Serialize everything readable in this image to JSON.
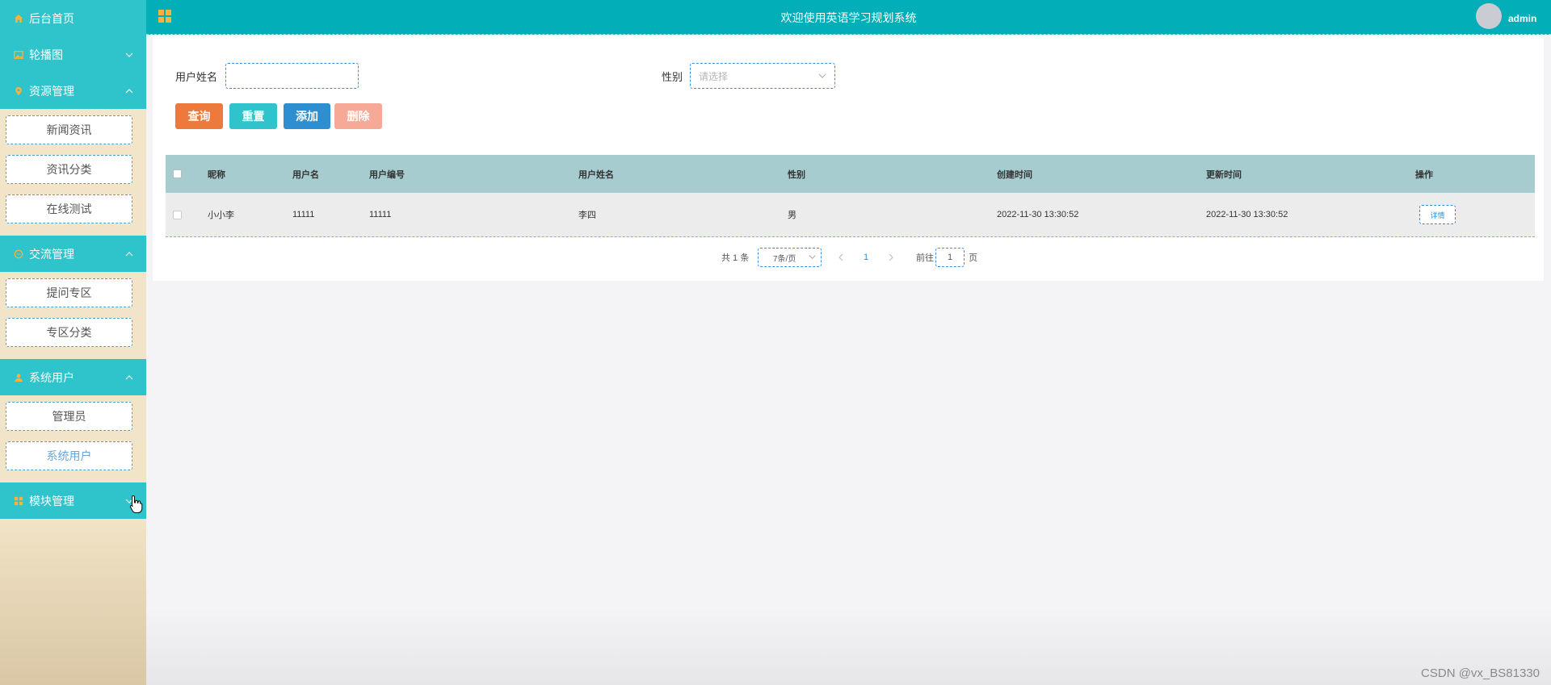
{
  "header": {
    "title": "欢迎使用英语学习规划系统",
    "username": "admin"
  },
  "sidebar": {
    "home": "后台首页",
    "carousel": "轮播图",
    "resource": {
      "label": "资源管理",
      "items": [
        "新闻资讯",
        "资讯分类",
        "在线测试"
      ]
    },
    "exchange": {
      "label": "交流管理",
      "items": [
        "提问专区",
        "专区分类"
      ]
    },
    "sysuser": {
      "label": "系统用户",
      "items": [
        "管理员",
        "系统用户"
      ]
    },
    "module": "模块管理"
  },
  "form": {
    "name_label": "用户姓名",
    "name_value": "",
    "gender_label": "性别",
    "gender_placeholder": "请选择"
  },
  "buttons": {
    "search": "查询",
    "reset": "重置",
    "add": "添加",
    "delete": "删除"
  },
  "table": {
    "headers": [
      "昵称",
      "用户名",
      "用户编号",
      "用户姓名",
      "性别",
      "创建时间",
      "更新时间",
      "操作"
    ],
    "rows": [
      [
        "小小李",
        "11111",
        "11111",
        "李四",
        "男",
        "2022-11-30 13:30:52",
        "2022-11-30 13:30:52"
      ]
    ],
    "detail_label": "详情"
  },
  "pagination": {
    "total": "共 1 条",
    "page_size": "7条/页",
    "current": "1",
    "goto_label": "前往",
    "goto_value": "1",
    "page_suffix": "页"
  },
  "watermark": "CSDN @vx_BS81330",
  "colors": {
    "sidebar_accent": "#2fc3cc",
    "header": "#02aeb7",
    "search_btn": "#ec7a3c",
    "reset_btn": "#2fc3cc",
    "add_btn": "#2e8fd0",
    "delete_btn": "#f5a996"
  }
}
